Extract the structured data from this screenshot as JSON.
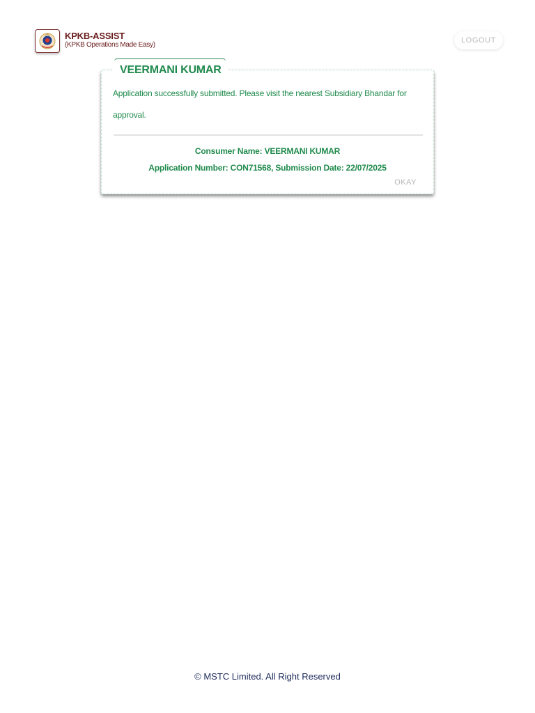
{
  "header": {
    "app_title": "KPKB-ASSIST",
    "app_subtitle": "(KPKB Operations Made Easy)",
    "logo_icon": "emblem-icon",
    "logout_label": "LOGOUT"
  },
  "dialog": {
    "title": "VEERMANI KUMAR",
    "message": "Application successfully submitted. Please visit the nearest Subsidiary Bhandar for approval.",
    "consumer_line": "Consumer Name: VEERMANI KUMAR",
    "application_line": "Application Number: CON71568, Submission Date: 22/07/2025",
    "okay_label": "OKAY"
  },
  "footer": {
    "copyright": "© MSTC Limited. All Right Reserved"
  },
  "colors": {
    "brand": "#6b1d1d",
    "success": "#1f8a4c",
    "footer_text": "#1d2a5a"
  }
}
